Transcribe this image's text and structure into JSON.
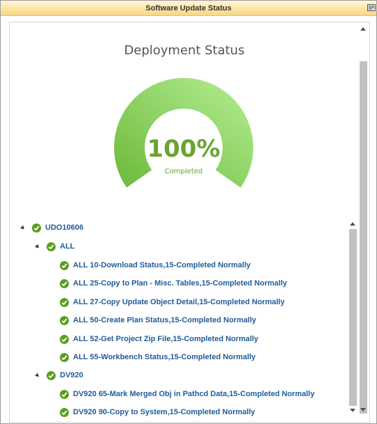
{
  "window": {
    "title": "Software Update Status",
    "corner_icon": "window-menu-icon"
  },
  "gauge": {
    "title": "Deployment Status",
    "value_text": "100%",
    "caption": "Completed",
    "percent": 100,
    "colors": {
      "light": "#b4ef93",
      "dark": "#6cb83a",
      "text": "#6aa332"
    }
  },
  "tree": {
    "root": {
      "label": "UDO10606",
      "groups": [
        {
          "label": "ALL",
          "items": [
            "ALL 10-Download Status,15-Completed Normally",
            "ALL 25-Copy to Plan - Misc. Tables,15-Completed Normally",
            "ALL 27-Copy Update Object Detail,15-Completed Normally",
            "ALL 50-Create Plan Status,15-Completed Normally",
            "ALL 52-Get Project Zip File,15-Completed Normally",
            "ALL 55-Workbench Status,15-Completed Normally"
          ]
        },
        {
          "label": "DV920",
          "items": [
            "DV920 65-Mark Merged Obj in Pathcd Data,15-Completed Normally",
            "DV920 90-Copy to System,15-Completed Normally"
          ]
        }
      ]
    },
    "status_icon": "check-circle-icon",
    "status_color": "#5a9e1e"
  }
}
